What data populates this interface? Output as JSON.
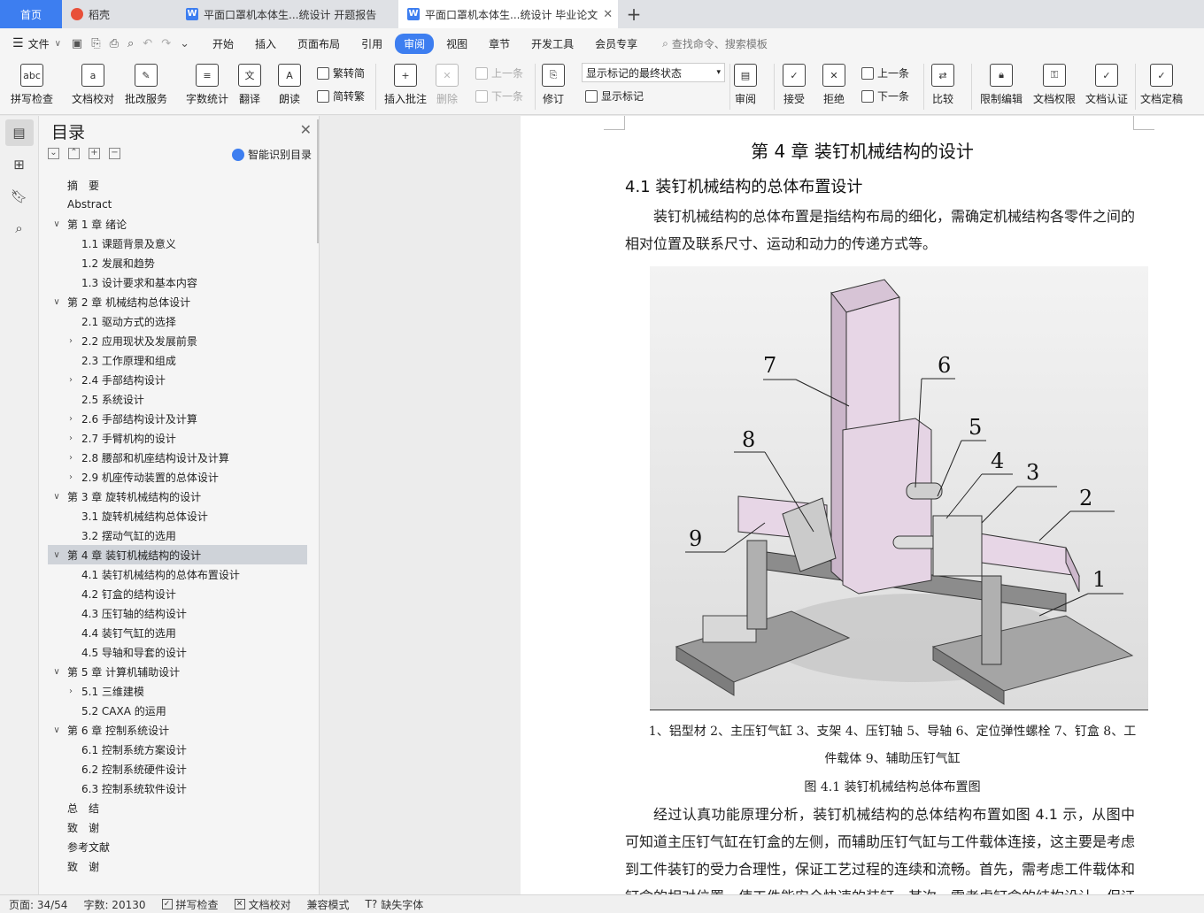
{
  "tabs": {
    "home": "首页",
    "docer": "稻壳",
    "doc1": "平面口罩机本体生...统设计 开题报告",
    "doc2": "平面口罩机本体生...统设计 毕业论文",
    "add": "+"
  },
  "menu": {
    "file": "文件",
    "items": [
      "开始",
      "插入",
      "页面布局",
      "引用",
      "审阅",
      "视图",
      "章节",
      "开发工具",
      "会员专享"
    ],
    "search": "查找命令、搜索模板"
  },
  "ribbon": {
    "spell": "拼写检查",
    "proofread": "文档校对",
    "batch": "批改服务",
    "wordcount": "字数统计",
    "translate": "翻译",
    "read": "朗读",
    "to_trad": "繁转简",
    "to_simp": "简转繁",
    "insert_comment": "插入批注",
    "delete": "删除",
    "prev": "上一条",
    "next": "下一条",
    "track": "修订",
    "markup_select": "显示标记的最终状态",
    "show_markup": "显示标记",
    "review": "审阅",
    "accept": "接受",
    "reject": "拒绝",
    "prev2": "上一条",
    "next2": "下一条",
    "compare": "比较",
    "restrict": "限制编辑",
    "rights": "文档权限",
    "certify": "文档认证",
    "finalize": "文档定稿"
  },
  "toc": {
    "title": "目录",
    "ai_label": "智能识别目录",
    "items": [
      {
        "text": "摘　要",
        "level": 1,
        "caret": ""
      },
      {
        "text": "Abstract",
        "level": 1,
        "caret": ""
      },
      {
        "text": "第 1 章  绪论",
        "level": 1,
        "caret": "v"
      },
      {
        "text": "1.1  课题背景及意义",
        "level": 2,
        "caret": ""
      },
      {
        "text": "1.2  发展和趋势",
        "level": 2,
        "caret": ""
      },
      {
        "text": "1.3  设计要求和基本内容",
        "level": 2,
        "caret": ""
      },
      {
        "text": "第 2 章  机械结构总体设计",
        "level": 1,
        "caret": "v"
      },
      {
        "text": "2.1  驱动方式的选择",
        "level": 2,
        "caret": ""
      },
      {
        "text": "2.2  应用现状及发展前景",
        "level": 2,
        "caret": ">"
      },
      {
        "text": "2.3  工作原理和组成",
        "level": 2,
        "caret": ""
      },
      {
        "text": "2.4 手部结构设计",
        "level": 2,
        "caret": ">"
      },
      {
        "text": "2.5 系统设计",
        "level": 2,
        "caret": ""
      },
      {
        "text": "2.6 手部结构设计及计算",
        "level": 2,
        "caret": ">"
      },
      {
        "text": "2.7 手臂机构的设计",
        "level": 2,
        "caret": ">"
      },
      {
        "text": "2.8 腰部和机座结构设计及计算",
        "level": 2,
        "caret": ">"
      },
      {
        "text": "2.9 机座传动装置的总体设计",
        "level": 2,
        "caret": ">"
      },
      {
        "text": "第 3 章  旋转机械结构的设计",
        "level": 1,
        "caret": "v"
      },
      {
        "text": "3.1 旋转机械结构总体设计",
        "level": 2,
        "caret": ""
      },
      {
        "text": "3.2 摆动气缸的选用",
        "level": 2,
        "caret": ""
      },
      {
        "text": "第 4 章  装钉机械结构的设计",
        "level": 1,
        "caret": "v",
        "selected": true
      },
      {
        "text": "4.1  装钉机械结构的总体布置设计",
        "level": 2,
        "caret": ""
      },
      {
        "text": "4.2 钉盒的结构设计",
        "level": 2,
        "caret": ""
      },
      {
        "text": "4.3 压钉轴的结构设计",
        "level": 2,
        "caret": ""
      },
      {
        "text": "4.4 装钉气缸的选用",
        "level": 2,
        "caret": ""
      },
      {
        "text": "4.5 导轴和导套的设计",
        "level": 2,
        "caret": ""
      },
      {
        "text": "第 5 章  计算机辅助设计",
        "level": 1,
        "caret": "v"
      },
      {
        "text": "5.1  三维建模",
        "level": 2,
        "caret": ">"
      },
      {
        "text": "5.2 CAXA 的运用",
        "level": 2,
        "caret": ""
      },
      {
        "text": "第 6 章  控制系统设计",
        "level": 1,
        "caret": "v"
      },
      {
        "text": "6.1 控制系统方案设计",
        "level": 2,
        "caret": ""
      },
      {
        "text": "6.2 控制系统硬件设计",
        "level": 2,
        "caret": ""
      },
      {
        "text": "6.3 控制系统软件设计",
        "level": 2,
        "caret": ""
      },
      {
        "text": "总　结",
        "level": 1,
        "caret": ""
      },
      {
        "text": "致　谢",
        "level": 1,
        "caret": ""
      },
      {
        "text": "参考文献",
        "level": 1,
        "caret": ""
      },
      {
        "text": "致　谢",
        "level": 1,
        "caret": ""
      }
    ]
  },
  "document": {
    "chapter_title": "第 4 章  装钉机械结构的设计",
    "section_title": "4.1  装钉机械结构的总体布置设计",
    "para1": "装钉机械结构的总体布置是指结构布局的细化，需确定机械结构各零件之间的相对位置及联系尺寸、运动和动力的传递方式等。",
    "figure_labels": [
      "1",
      "2",
      "3",
      "4",
      "5",
      "6",
      "7",
      "8",
      "9"
    ],
    "caption_line1": "1、铝型材 2、主压钉气缸 3、支架 4、压钉轴 5、导轴 6、定位弹性螺栓 7、钉盒 8、工",
    "caption_line2": "件载体 9、辅助压钉气缸",
    "figure_title": "图 4.1 装钉机械结构总体布置图",
    "para2": "经过认真功能原理分析，装钉机械结构的总体结构布置如图 4.1 示，从图中可知道主压钉气缸在钉盒的左侧，而辅助压钉气缸与工件载体连接，这主要是考虑到工件装钉的受力合理性，保证工艺过程的连续和流畅。首先，需考虑工件载体和钉盒的相对位置，使工件能安全快速的装钉。其次，需考虑钉盒的结构设计，保证供"
  },
  "status": {
    "page": "页面: 34/54",
    "words": "字数: 20130",
    "spell": "拼写检查",
    "proof": "文档校对",
    "compat": "兼容模式",
    "missing_font": "缺失字体"
  },
  "colors": {
    "accent": "#3d7ef0",
    "selected_toc": "#cfd3d9",
    "machine_pink": "#e7d6e6"
  }
}
